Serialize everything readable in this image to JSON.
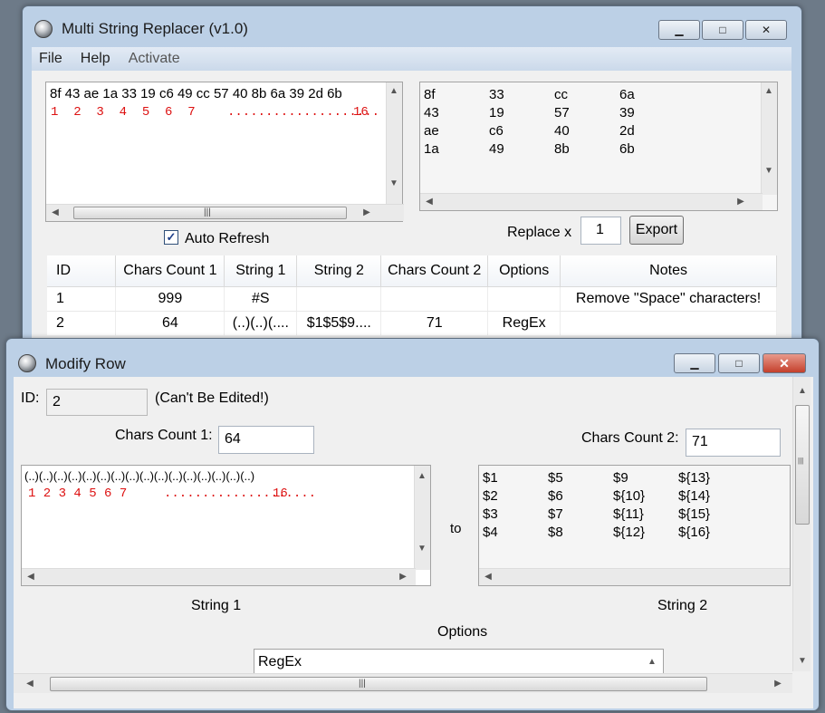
{
  "main": {
    "title": "Multi String Replacer (v1.0)",
    "menu": [
      "File",
      "Help",
      "Activate"
    ],
    "input_text": "8f 43 ae 1a 33 19 c6 49 cc 57 40 8b 6a 39 2d 6b",
    "input_index": "1  2  3  4  5  6  7",
    "input_dots": "....................",
    "input_last": "16",
    "output_columns": [
      [
        "8f",
        "43",
        "ae",
        "1a"
      ],
      [
        "33",
        "19",
        "c6",
        "49"
      ],
      [
        "cc",
        "57",
        "40",
        "8b"
      ],
      [
        "6a",
        "39",
        "2d",
        "6b"
      ]
    ],
    "auto_refresh": {
      "label": "Auto Refresh",
      "checked": true,
      "mark": "✓"
    },
    "replace_label": "Replace x",
    "replace_value": "1",
    "export_label": "Export",
    "table": {
      "headers": [
        "ID",
        "Chars Count 1",
        "String 1",
        "String 2",
        "Chars Count 2",
        "Options",
        "Notes"
      ],
      "rows": [
        [
          "1",
          "999",
          "#S",
          "",
          "",
          "",
          "Remove \"Space\" characters!"
        ],
        [
          "2",
          "64",
          "(..)(..)(....",
          "$1$5$9....",
          "71",
          "RegEx",
          ""
        ]
      ]
    }
  },
  "modify": {
    "title": "Modify Row",
    "id_label": "ID:",
    "id_value": "2",
    "id_note": "(Can't Be Edited!)",
    "cc1_label": "Chars Count 1:",
    "cc1_value": "64",
    "cc2_label": "Chars Count 2:",
    "cc2_value": "71",
    "string1_text": "(..)(..)(..)(..)(..)(..)(..)(..)(..)(..)(..)(..)(..)(..)(..)(..)",
    "string1_index": "1 2 3 4 5 6 7",
    "string1_dots": "....................",
    "string1_last": "16",
    "to_label": "to",
    "string2_columns": [
      [
        "$1",
        "$2",
        "$3",
        "$4"
      ],
      [
        "$5",
        "$6",
        "$7",
        "$8"
      ],
      [
        "$9",
        "${10}",
        "${11}",
        "${12}"
      ],
      [
        "${13}",
        "${14}",
        "${15}",
        "${16}"
      ]
    ],
    "string1_label": "String 1",
    "string2_label": "String 2",
    "options_label": "Options",
    "options_value": "RegEx"
  },
  "icons": {
    "minimize": "▁",
    "maximize": "□",
    "close": "✕",
    "scroll_up": "▲",
    "scroll_down": "▼",
    "scroll_left": "◀",
    "scroll_right": "▶",
    "grip": "|||"
  }
}
